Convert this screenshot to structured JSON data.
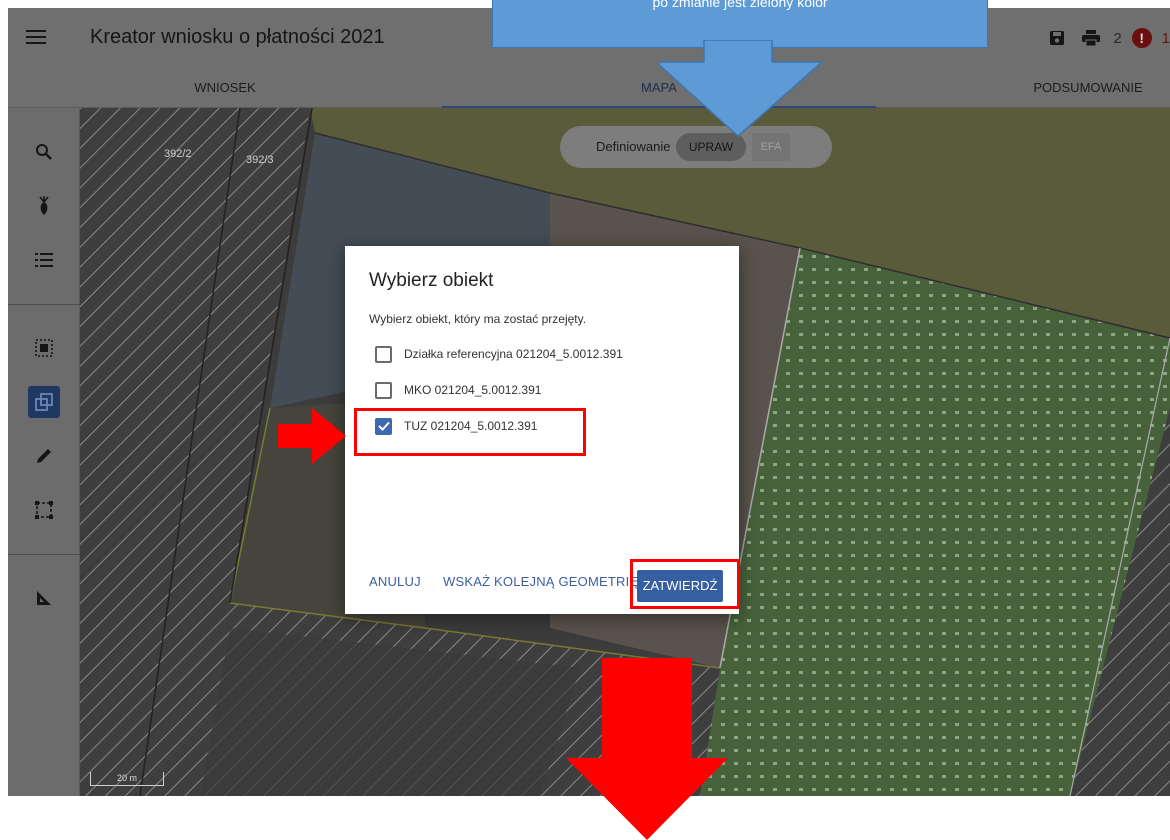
{
  "header": {
    "title": "Kreator wniosku o płatności 2021",
    "warning_count": "2",
    "error_count": "1",
    "error_icon_glyph": "!"
  },
  "tabs": [
    {
      "label": "WNIOSEK"
    },
    {
      "label": "MAPA"
    },
    {
      "label": "PODSUMOWANIE"
    }
  ],
  "sidebar": {
    "icons": [
      "search-icon",
      "plant-icon",
      "list-icon",
      "select-area-icon",
      "take-geometry-icon",
      "pencil-icon",
      "draw-rectangle-icon",
      "measure-icon"
    ]
  },
  "map": {
    "parcel_labels": [
      "392/2",
      "392/3"
    ],
    "defining_label": "Definiowanie",
    "upraw_label": "UPRAW",
    "efa_label": "EFA",
    "scale_label": "20 m"
  },
  "modal": {
    "title": "Wybierz obiekt",
    "description": "Wybierz obiekt, który ma zostać przejęty.",
    "options": [
      {
        "label": "Działka referencyjna 021204_5.0012.391",
        "checked": false
      },
      {
        "label": "MKO 021204_5.0012.391",
        "checked": false
      },
      {
        "label": "TUZ 021204_5.0012.391",
        "checked": true
      }
    ],
    "cancel_label": "ANULUJ",
    "next_label": "WSKAŻ KOLEJNĄ GEOMETRIĘ",
    "confirm_label": "ZATWIERDŹ"
  },
  "annotation": {
    "callout_text": "po zmianie jest zielony kolor"
  },
  "colors": {
    "accent": "#355ea3",
    "highlight": "#ff0000",
    "callout": "#5e9bd6"
  }
}
